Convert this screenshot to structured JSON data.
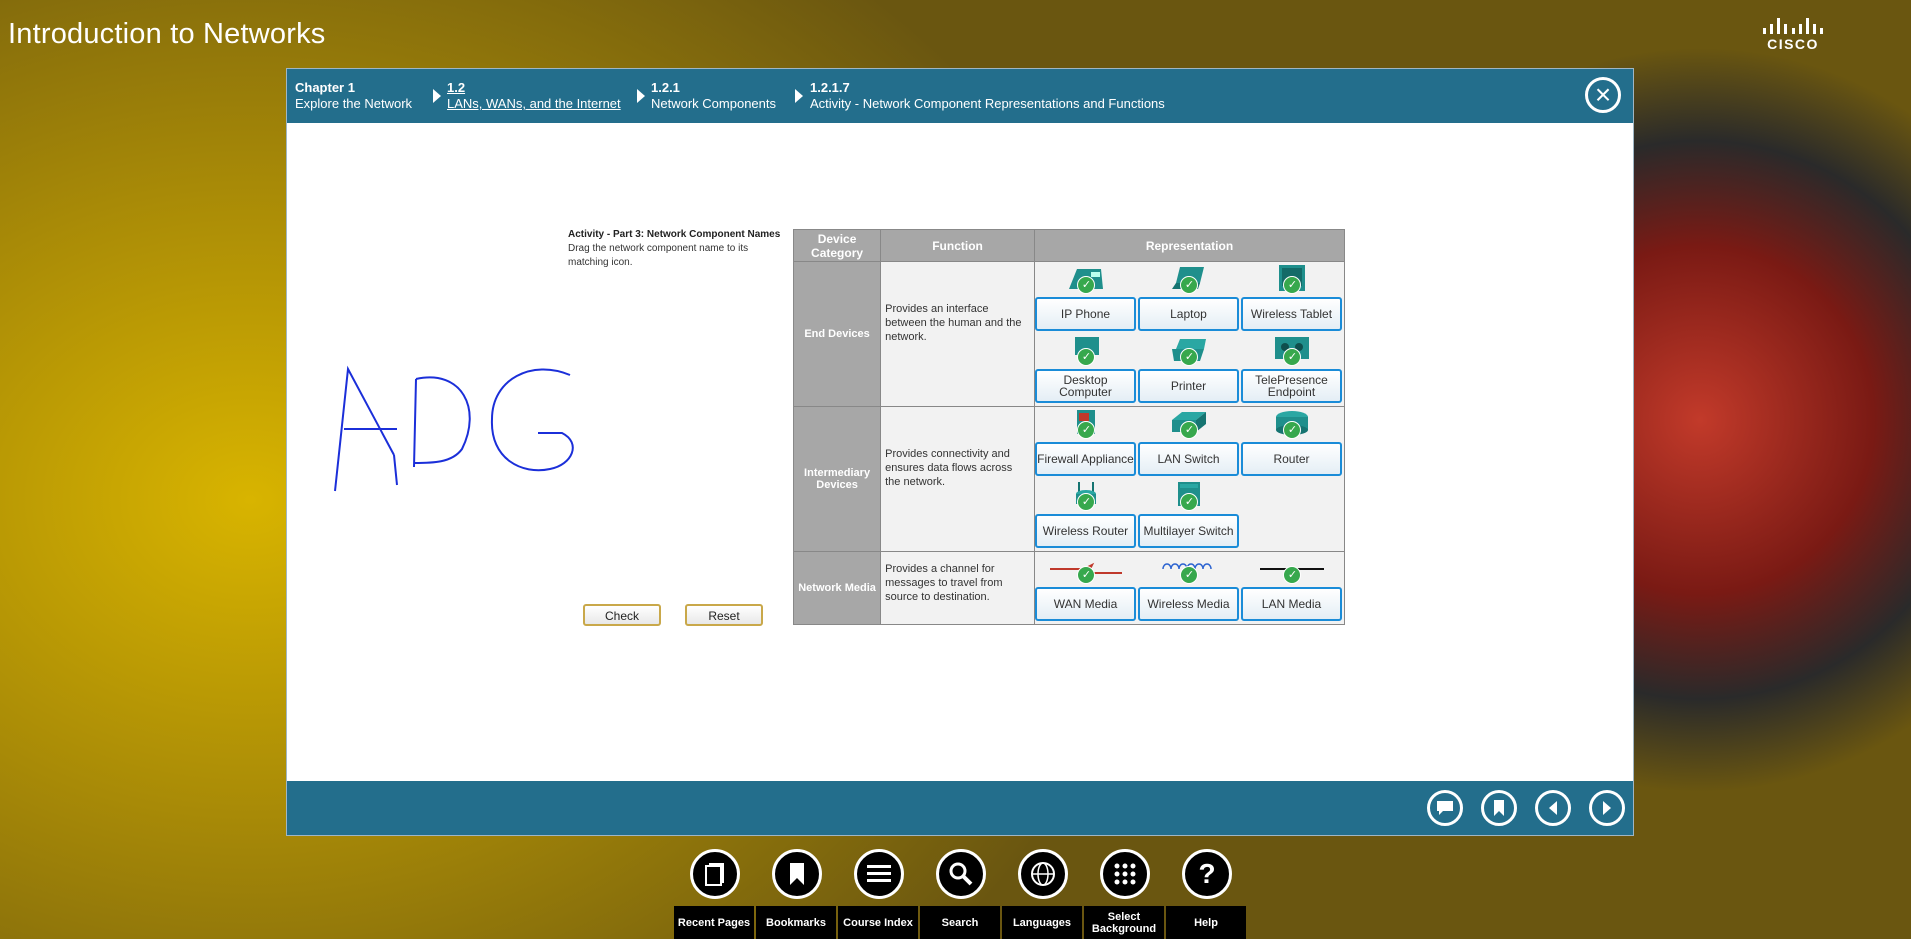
{
  "app": {
    "title": "Introduction to Networks",
    "brand": "CISCO"
  },
  "breadcrumbs": [
    {
      "num": "Chapter 1",
      "label": "Explore the Network"
    },
    {
      "num": "1.2",
      "label": "LANs, WANs, and the Internet"
    },
    {
      "num": "1.2.1",
      "label": "Network Components"
    },
    {
      "num": "1.2.1.7",
      "label": "Activity - Network Component Representations and Functions"
    }
  ],
  "activity": {
    "title": "Activity - Part 3: Network Component Names",
    "instructions": "Drag the network component name to its matching icon.",
    "check_label": "Check",
    "reset_label": "Reset"
  },
  "table": {
    "headers": [
      "Device Category",
      "Function",
      "Representation"
    ],
    "rows": [
      {
        "category": "End Devices",
        "function": "Provides an interface between the human and the network.",
        "items": [
          "IP Phone",
          "Laptop",
          "Wireless Tablet",
          "Desktop Computer",
          "Printer",
          "TelePresence Endpoint"
        ]
      },
      {
        "category": "Intermediary Devices",
        "function": "Provides connectivity and ensures data flows across the network.",
        "items": [
          "Firewall Appliance",
          "LAN Switch",
          "Router",
          "Wireless Router",
          "Multilayer Switch"
        ]
      },
      {
        "category": "Network Media",
        "function": "Provides a channel for messages to travel from source to destination.",
        "items": [
          "WAN Media",
          "Wireless Media",
          "LAN Media"
        ]
      }
    ]
  },
  "footer_nav": [
    {
      "icon": "recent-pages-icon",
      "label": "Recent Pages"
    },
    {
      "icon": "bookmarks-icon",
      "label": "Bookmarks"
    },
    {
      "icon": "course-index-icon",
      "label": "Course Index"
    },
    {
      "icon": "search-icon",
      "label": "Search"
    },
    {
      "icon": "languages-icon",
      "label": "Languages"
    },
    {
      "icon": "select-background-icon",
      "label": "Select Background"
    },
    {
      "icon": "help-icon",
      "label": "Help"
    }
  ],
  "colors": {
    "header_blue": "#236e8c",
    "label_border": "#1a8cd8",
    "check_green": "#37a84d"
  }
}
